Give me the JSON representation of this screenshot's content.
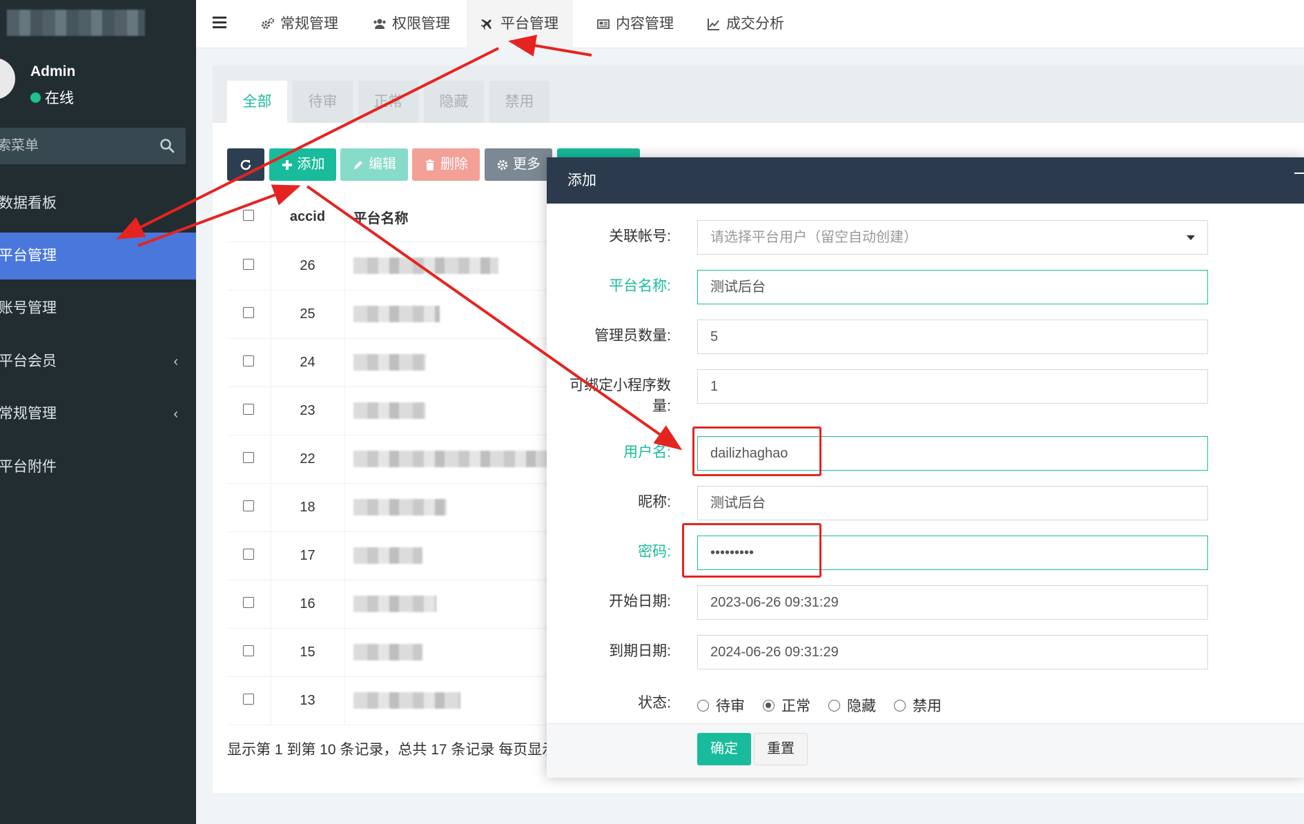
{
  "sidebar": {
    "user": {
      "name": "Admin",
      "status": "在线"
    },
    "search_placeholder": "索菜单",
    "items": [
      {
        "label": "数据看板",
        "active": false,
        "has_children": false
      },
      {
        "label": "平台管理",
        "active": true,
        "has_children": false
      },
      {
        "label": "账号管理",
        "active": false,
        "has_children": false
      },
      {
        "label": "平台会员",
        "active": false,
        "has_children": true
      },
      {
        "label": "常规管理",
        "active": false,
        "has_children": true
      },
      {
        "label": "平台附件",
        "active": false,
        "has_children": false
      }
    ],
    "chevron": "‹"
  },
  "topnav": {
    "tabs": [
      {
        "label": "常规管理",
        "icon": "gears-icon"
      },
      {
        "label": "权限管理",
        "icon": "users-icon"
      },
      {
        "label": "平台管理",
        "icon": "plane-icon",
        "active": true
      },
      {
        "label": "内容管理",
        "icon": "newspaper-icon"
      },
      {
        "label": "成交分析",
        "icon": "line-chart-icon"
      }
    ]
  },
  "panel": {
    "status_tabs": [
      "全部",
      "待审",
      "正常",
      "隐藏",
      "禁用"
    ],
    "toolbar": {
      "add": "添加",
      "edit": "编辑",
      "delete": "删除",
      "more": "更多"
    },
    "table": {
      "columns": [
        "accid",
        "平台名称"
      ],
      "rows": [
        {
          "accid": "26"
        },
        {
          "accid": "25"
        },
        {
          "accid": "24"
        },
        {
          "accid": "23"
        },
        {
          "accid": "22"
        },
        {
          "accid": "18"
        },
        {
          "accid": "17"
        },
        {
          "accid": "16"
        },
        {
          "accid": "15"
        },
        {
          "accid": "13"
        }
      ]
    },
    "footer": "显示第 1 到第 10 条记录，总共 17 条记录 每页显示"
  },
  "modal": {
    "title": "添加",
    "fields": {
      "account": {
        "label": "关联帐号:",
        "placeholder": "请选择平台用户（留空自动创建）"
      },
      "platform_name": {
        "label": "平台名称:",
        "value": "测试后台"
      },
      "admin_count": {
        "label": "管理员数量:",
        "value": "5"
      },
      "miniprogram_count": {
        "label_line1": "可绑定小程序数",
        "label_line2": "量:",
        "value": "1"
      },
      "username": {
        "label": "用户名:",
        "value": "dailizhaghao"
      },
      "nickname": {
        "label": "昵称:",
        "value": "测试后台"
      },
      "password": {
        "label": "密码:",
        "value": "•••••••••"
      },
      "start_date": {
        "label": "开始日期:",
        "value": "2023-06-26 09:31:29"
      },
      "end_date": {
        "label": "到期日期:",
        "value": "2024-06-26 09:31:29"
      }
    },
    "status": {
      "label": "状态:",
      "options": [
        "待审",
        "正常",
        "隐藏",
        "禁用"
      ],
      "selected": "正常"
    },
    "buttons": {
      "ok": "确定",
      "reset": "重置"
    }
  },
  "colors": {
    "sidebar_bg": "#222d32",
    "active_menu": "#4a77db",
    "accent_green": "#18bc9c",
    "modal_header": "#2b3b4d",
    "annotation_red": "#e52421"
  }
}
